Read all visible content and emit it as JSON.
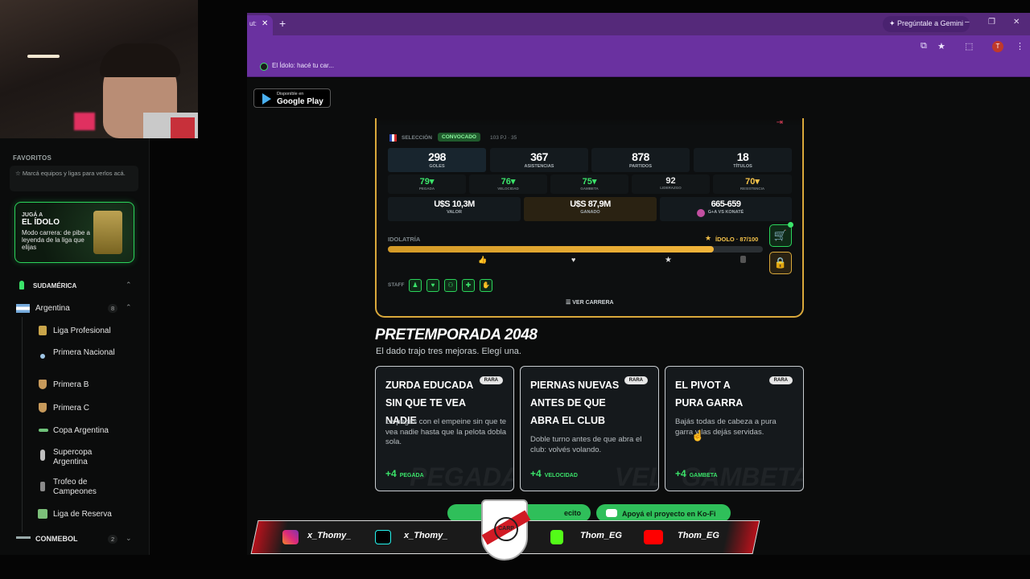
{
  "sidebar": {
    "favorites_title": "FAVORITOS",
    "favorites_hint": "Marcá equipos y ligas para verlos acá.",
    "promo": {
      "small": "JUGÁ A",
      "big": "EL ÍDOLO",
      "desc": "Modo carrera: de pibe a leyenda de la liga que elijas"
    },
    "region": "SUDAMÉRICA",
    "country": "Argentina",
    "country_count": "8",
    "leagues": [
      "Liga Profesional",
      "Primera Nacional",
      "Primera B",
      "Primera C",
      "Copa Argentina",
      "Supercopa Argentina",
      "Trofeo de Campeones",
      "Liga de Reserva"
    ],
    "conmebol": "CONMEBOL",
    "conmebol_count": "2"
  },
  "browser": {
    "tab_label": "ut:",
    "new_tab": "+",
    "gemini": "Pregúntale a Gemini",
    "bookmark": "El Ídolo: hacé tu car..."
  },
  "page": {
    "gplay_top": "Disponible en",
    "gplay_bottom": "Google Play",
    "seleccion_label": "SELECCIÓN",
    "convocado": "CONVOCADO",
    "seleccion_stats": "103 PJ · 35",
    "main_stats": [
      {
        "value": "298",
        "key": "GOLES"
      },
      {
        "value": "367",
        "key": "ASISTENCIAS"
      },
      {
        "value": "878",
        "key": "PARTIDOS"
      },
      {
        "value": "18",
        "key": "TÍTULOS"
      }
    ],
    "attributes": [
      {
        "value": "79▾",
        "key": "PEGADA"
      },
      {
        "value": "76▾",
        "key": "VELOCIDAD"
      },
      {
        "value": "75▾",
        "key": "GAMBETA"
      },
      {
        "value": "92",
        "key": "LIDERAZGO"
      },
      {
        "value": "70▾",
        "key": "RESISTENCIA"
      }
    ],
    "money": [
      {
        "value": "U$S 10,3M",
        "key": "VALOR"
      },
      {
        "value": "U$S 87,9M",
        "key": "GANADO"
      },
      {
        "value": "665-659",
        "key": "G+A VS KONATÉ"
      }
    ],
    "idolatria_label": "IDOLATRÍA",
    "idolo_status": "ÍDOLO · 87/100",
    "idolatria_value": 87,
    "staff_label": "STAFF",
    "ver_carrera": "VER CARRERA",
    "pre_title": "PRETEMPORADA 2048",
    "pre_sub": "El dado trajo tres mejoras. Elegí una.",
    "upgrades": [
      {
        "title": "ZURDA EDUCADA SIN QUE TE VEA NADIE",
        "badge": "RARA",
        "desc": "Le pegás con el empeine sin que te vea nadie hasta que la pelota dobla sola.",
        "bonus": "+4",
        "stat": "PEGADA",
        "watermark": "PEGADA"
      },
      {
        "title": "PIERNAS NUEVAS ANTES DE QUE ABRA EL CLUB",
        "badge": "RARA",
        "desc": "Doble turno antes de que abra el club: volvés volando.",
        "bonus": "+4",
        "stat": "VELOCIDAD",
        "watermark": "VEL"
      },
      {
        "title": "EL PIVOT A PURA GARRA",
        "badge": "RARA",
        "desc": "Bajás todas de cabeza a pura garra y las dejás servidas.",
        "bonus": "+4",
        "stat": "GAMBETA",
        "watermark": "GAMBETA"
      }
    ],
    "kofi_left": "ecito",
    "kofi_right": "Apoyá el proyecto en Ko-Fi"
  },
  "banner": {
    "instagram": "x_Thomy_",
    "tiktok": "x_Thomy_",
    "kick": "Thom_EG",
    "youtube": "Thom_EG",
    "shield": "CARP"
  },
  "colors": {
    "accent_green": "#3be36a",
    "gold": "#d9a83b",
    "browser_purple": "#6a31a0"
  }
}
